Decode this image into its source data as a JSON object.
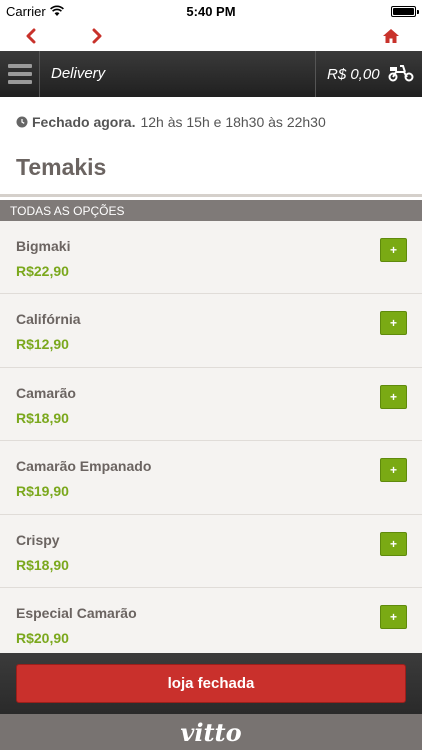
{
  "status_bar": {
    "carrier": "Carrier",
    "time": "5:40 PM"
  },
  "header": {
    "title": "Delivery",
    "cart_total": "R$ 0,00"
  },
  "store": {
    "status": "Fechado agora.",
    "hours": "12h às 15h e 18h30 às 22h30",
    "section_title": "Temakis"
  },
  "category": {
    "label": "TODAS AS OPÇÕES"
  },
  "items": [
    {
      "name": "Bigmaki",
      "price": "R$22,90",
      "add_label": "+"
    },
    {
      "name": "Califórnia",
      "price": "R$12,90",
      "add_label": "+"
    },
    {
      "name": "Camarão",
      "price": "R$18,90",
      "add_label": "+"
    },
    {
      "name": "Camarão Empanado",
      "price": "R$19,90",
      "add_label": "+"
    },
    {
      "name": "Crispy",
      "price": "R$18,90",
      "add_label": "+"
    },
    {
      "name": "Especial Camarão",
      "price": "R$20,90",
      "add_label": "+"
    }
  ],
  "footer": {
    "button_label": "loja fechada"
  },
  "brand": {
    "logo_text": "vitto"
  },
  "icons": {
    "back": "chevron-left-icon",
    "forward": "chevron-right-icon",
    "home": "home-icon",
    "menu": "hamburger-menu-icon",
    "delivery": "scooter-icon",
    "clock": "clock-icon"
  },
  "colors": {
    "accent_red": "#c9302c",
    "price_green": "#7ba81d",
    "add_green": "#7aaa14",
    "nav_red": "#c8322b"
  }
}
